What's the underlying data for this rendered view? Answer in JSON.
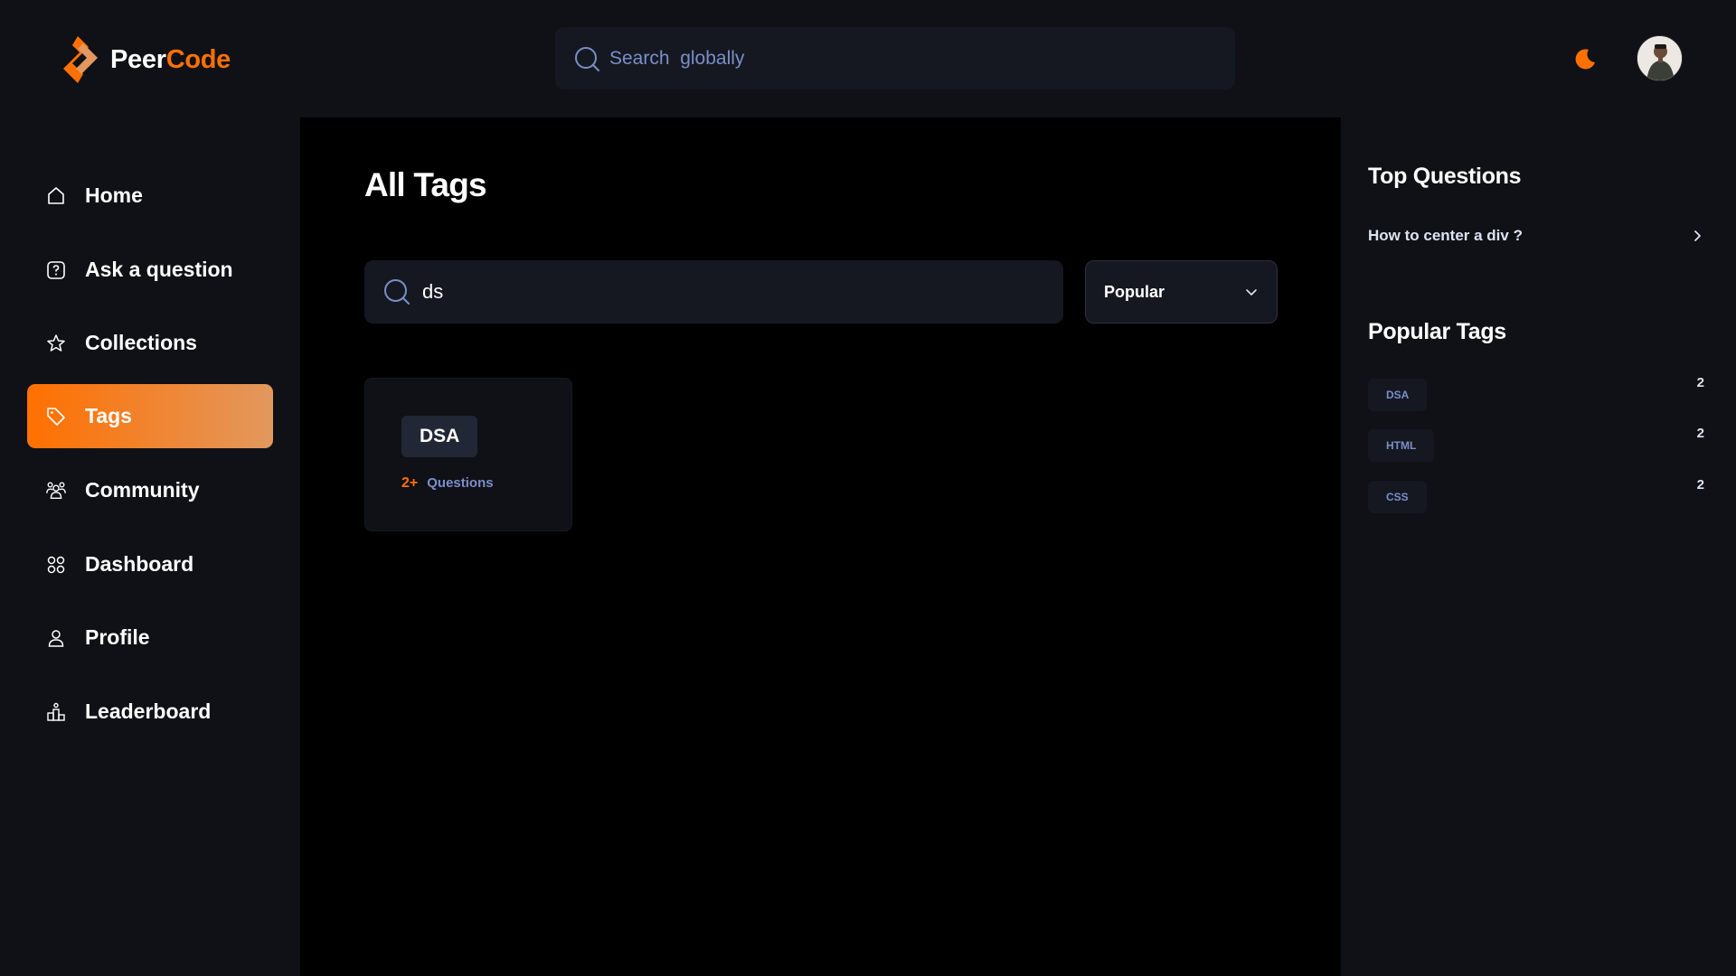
{
  "brand": {
    "name_part1": "Peer",
    "name_part2": "Code",
    "accent": "#ff7000"
  },
  "header": {
    "search_placeholder": "Search  globally",
    "theme_icon": "moon-icon",
    "avatar_icon": "user-avatar"
  },
  "sidebar": {
    "items": [
      {
        "label": "Home",
        "icon": "home-icon"
      },
      {
        "label": "Ask a question",
        "icon": "question-icon"
      },
      {
        "label": "Collections",
        "icon": "star-icon"
      },
      {
        "label": "Tags",
        "icon": "tag-icon",
        "active": true
      },
      {
        "label": "Community",
        "icon": "users-icon"
      },
      {
        "label": "Dashboard",
        "icon": "grid-icon"
      },
      {
        "label": "Profile",
        "icon": "user-icon"
      },
      {
        "label": "Leaderboard",
        "icon": "podium-icon"
      }
    ]
  },
  "main": {
    "title": "All Tags",
    "search_value": "ds",
    "filter": {
      "selected": "Popular"
    },
    "tags": [
      {
        "name": "DSA",
        "count": "2+",
        "count_label": "Questions"
      }
    ]
  },
  "rightbar": {
    "top_questions_title": "Top Questions",
    "questions": [
      {
        "text": "How to center a div ?"
      }
    ],
    "popular_tags_title": "Popular Tags",
    "popular_tags": [
      {
        "name": "DSA",
        "count": "2"
      },
      {
        "name": "HTML",
        "count": "2"
      },
      {
        "name": "CSS",
        "count": "2"
      }
    ]
  }
}
